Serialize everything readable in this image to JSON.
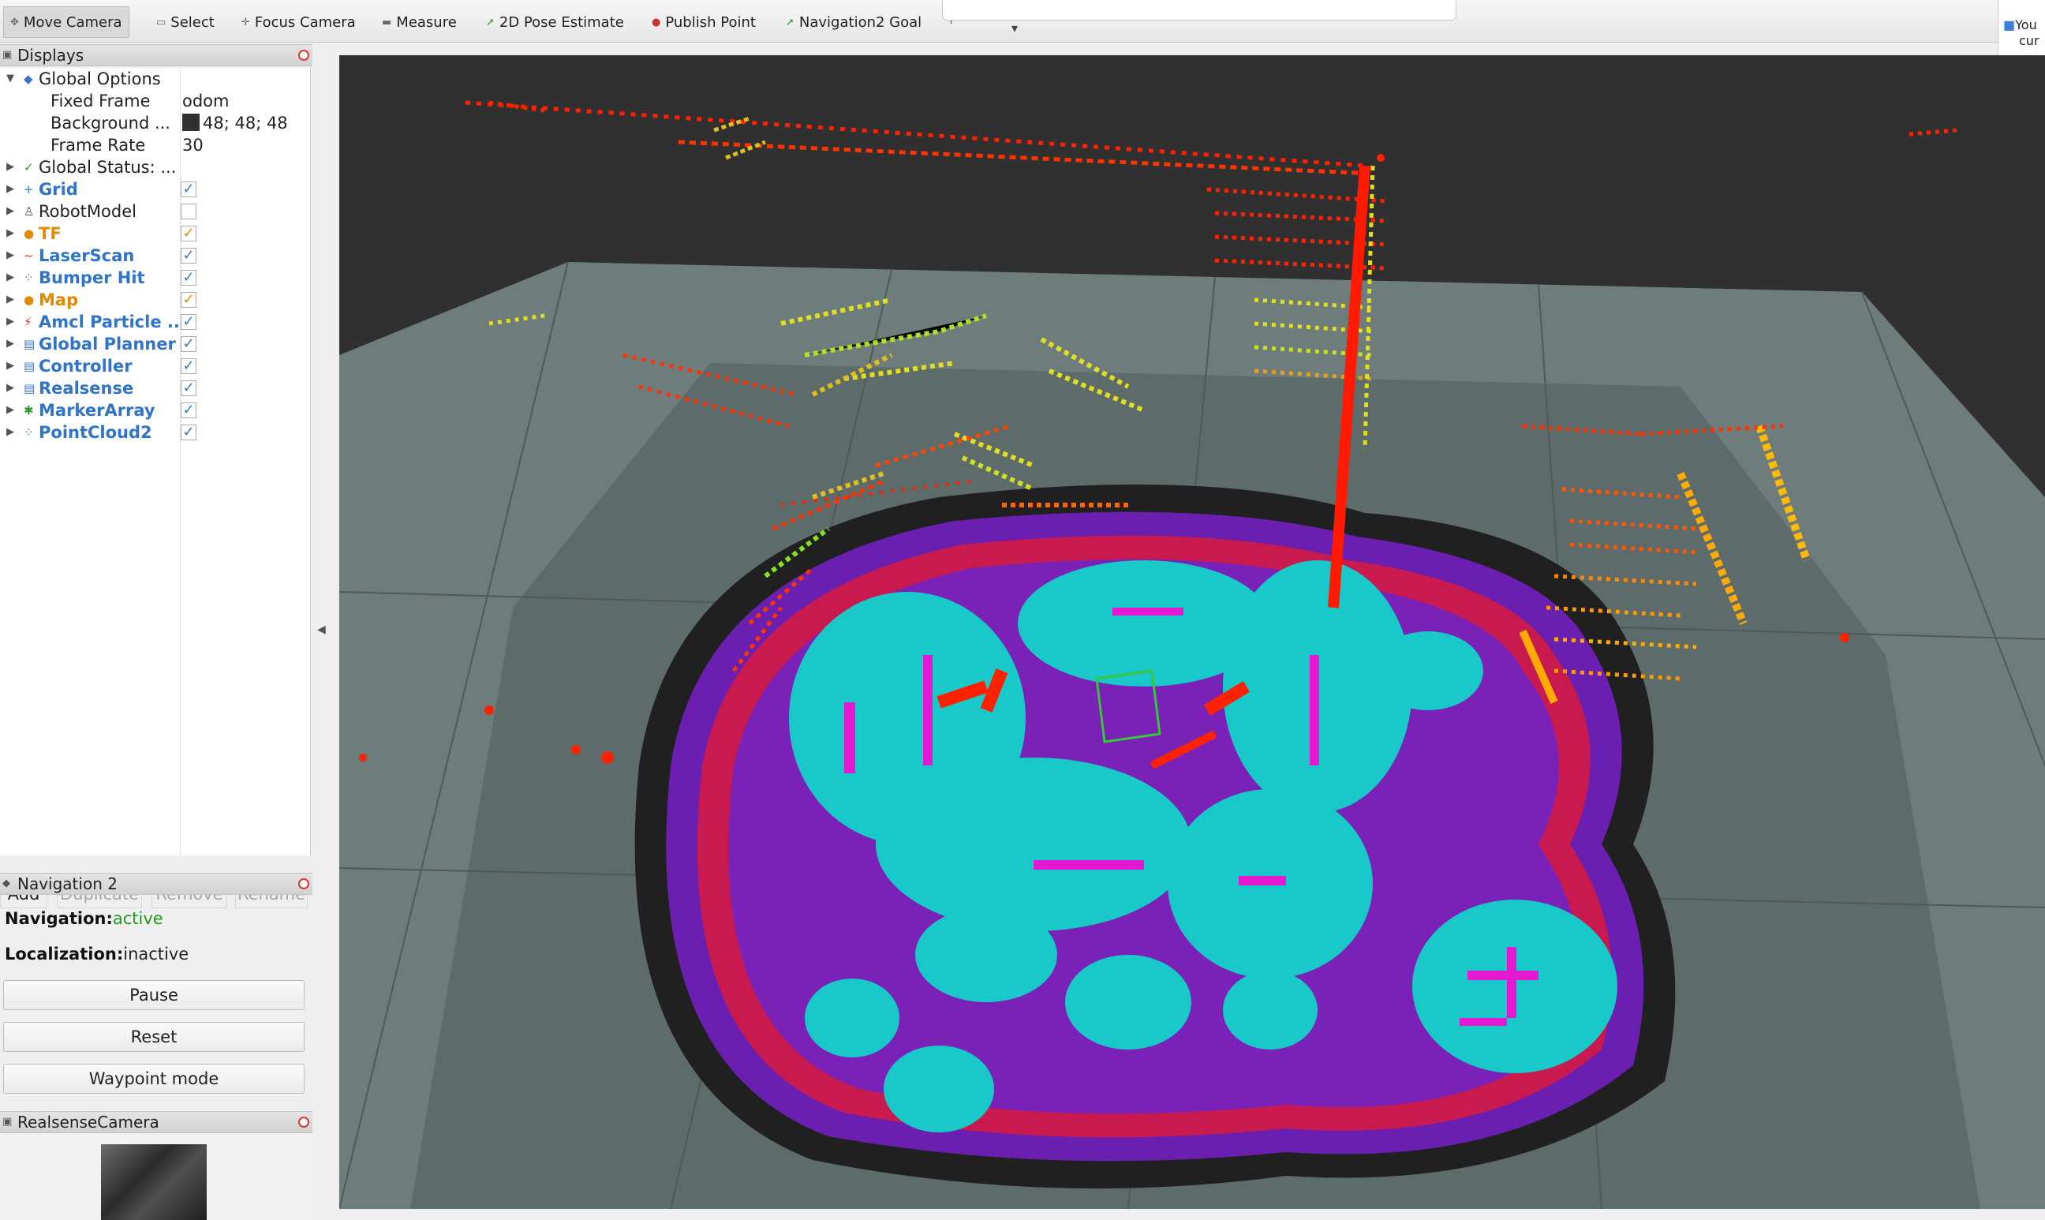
{
  "toolbar": {
    "tools": [
      {
        "label": "Move Camera",
        "icon": "move-camera-icon"
      },
      {
        "label": "Select",
        "icon": "select-icon"
      },
      {
        "label": "Focus Camera",
        "icon": "focus-camera-icon"
      },
      {
        "label": "Measure",
        "icon": "measure-icon"
      },
      {
        "label": "2D Pose Estimate",
        "icon": "pose-estimate-icon"
      },
      {
        "label": "Publish Point",
        "icon": "publish-point-icon"
      },
      {
        "label": "Navigation2 Goal",
        "icon": "nav-goal-icon"
      }
    ]
  },
  "notification": {
    "line1": "You",
    "line2": "cur"
  },
  "displays": {
    "title": "Displays",
    "global_options": {
      "label": "Global Options",
      "fixed_frame_label": "Fixed Frame",
      "fixed_frame_value": "odom",
      "background_label": "Background ...",
      "background_value": "48; 48; 48",
      "background_color": "#303030",
      "frame_rate_label": "Frame Rate",
      "frame_rate_value": "30"
    },
    "global_status": "Global Status: ...",
    "items": [
      {
        "label": "Grid",
        "checked": true
      },
      {
        "label": "RobotModel",
        "checked": false
      },
      {
        "label": "TF",
        "checked": true
      },
      {
        "label": "LaserScan",
        "checked": true
      },
      {
        "label": "Bumper Hit",
        "checked": true
      },
      {
        "label": "Map",
        "checked": true
      },
      {
        "label": "Amcl Particle ...",
        "checked": true
      },
      {
        "label": "Global Planner",
        "checked": true
      },
      {
        "label": "Controller",
        "checked": true
      },
      {
        "label": "Realsense",
        "checked": true
      },
      {
        "label": "MarkerArray",
        "checked": true
      },
      {
        "label": "PointCloud2",
        "checked": true
      }
    ],
    "buttons": {
      "add": "Add",
      "duplicate": "Duplicate",
      "remove": "Remove",
      "rename": "Rename"
    }
  },
  "navigation": {
    "title": "Navigation 2",
    "nav_label": "Navigation:",
    "nav_value": "active",
    "loc_label": "Localization:",
    "loc_value": "inactive",
    "pause": "Pause",
    "reset": "Reset",
    "waypoint": "Waypoint mode"
  },
  "camera": {
    "title": "RealsenseCamera"
  },
  "colors": {
    "viewport_bg": "#303030",
    "map_gray": "#5f6b6b",
    "costmap_cyan": "#19c8c8",
    "costmap_magenta": "#e619d2",
    "costmap_red": "#e6193c",
    "costmap_purple": "#6a1fb0",
    "laser_red": "#ff2200",
    "laser_yellow": "#e0e020"
  }
}
